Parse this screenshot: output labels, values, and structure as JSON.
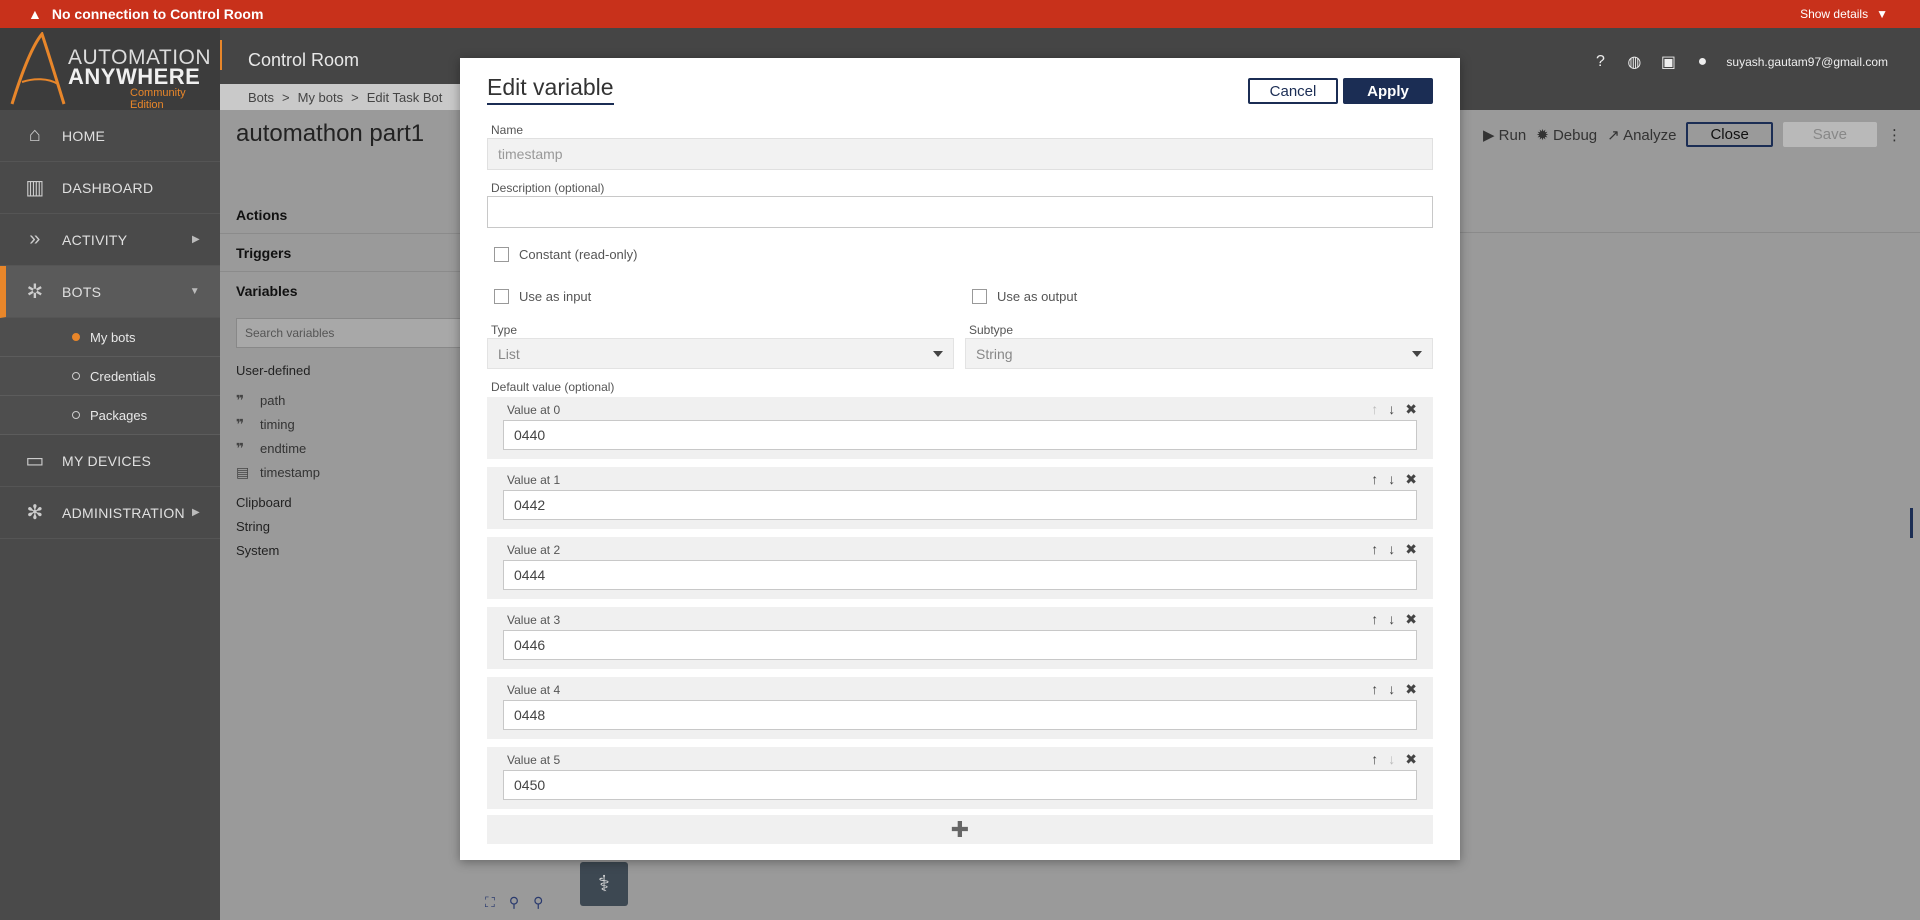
{
  "warning_bar": {
    "message": "No connection to Control Room",
    "details_label": "Show details"
  },
  "logo": {
    "line1": "AUTOMATION",
    "line2": "ANYWHERE",
    "edition": "Community Edition"
  },
  "header": {
    "app_title": "Control Room",
    "user_email": "suyash.gautam97@gmail.com"
  },
  "sidebar": {
    "items": [
      {
        "label": "HOME",
        "icon": "home-icon"
      },
      {
        "label": "DASHBOARD",
        "icon": "dashboard-icon"
      },
      {
        "label": "ACTIVITY",
        "icon": "activity-icon"
      },
      {
        "label": "BOTS",
        "icon": "bots-icon"
      },
      {
        "label": "MY DEVICES",
        "icon": "laptop-icon"
      },
      {
        "label": "ADMINISTRATION",
        "icon": "gear-icon"
      }
    ],
    "bots_sub": [
      "My bots",
      "Credentials",
      "Packages"
    ]
  },
  "breadcrumb": [
    "Bots",
    ">",
    "My bots",
    ">",
    "Edit Task Bot"
  ],
  "bot": {
    "title": "automathon part1"
  },
  "toolbar": {
    "run": "Run",
    "debug": "Debug",
    "analyze": "Analyze",
    "close": "Close",
    "save": "Save"
  },
  "left_panel": {
    "actions": "Actions",
    "triggers": "Triggers",
    "variables": "Variables",
    "search_placeholder": "Search variables",
    "user_defined": "User-defined",
    "vars": [
      "path",
      "timing",
      "endtime",
      "timestamp"
    ],
    "groups": [
      "Clipboard",
      "String",
      "System"
    ]
  },
  "modal": {
    "title": "Edit variable",
    "cancel": "Cancel",
    "apply": "Apply",
    "name_label": "Name",
    "name_value": "timestamp",
    "desc_label": "Description (optional)",
    "constant_label": "Constant (read-only)",
    "input_label": "Use as input",
    "output_label": "Use as output",
    "type_label": "Type",
    "type_value": "List",
    "subtype_label": "Subtype",
    "subtype_value": "String",
    "default_label": "Default value (optional)",
    "values": [
      {
        "label": "Value at 0",
        "value": "0440"
      },
      {
        "label": "Value at 1",
        "value": "0442"
      },
      {
        "label": "Value at 2",
        "value": "0444"
      },
      {
        "label": "Value at 3",
        "value": "0446"
      },
      {
        "label": "Value at 4",
        "value": "0448"
      },
      {
        "label": "Value at 5",
        "value": "0450"
      }
    ]
  },
  "colors": {
    "warning": "#c8311b",
    "accent": "#e8862a",
    "primary": "#1b2d54"
  }
}
